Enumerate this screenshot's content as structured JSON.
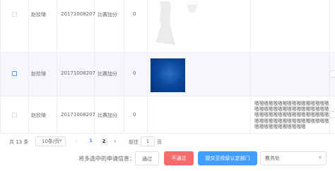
{
  "table": {
    "rows": [
      {
        "name": "赵欣琦",
        "id": "20171008207",
        "type": "比赛加分",
        "score": "0",
        "selected": false
      },
      {
        "name": "赵欣琦",
        "id": "20171008207",
        "type": "比赛加分",
        "score": "0",
        "selected": false
      },
      {
        "name": "赵欣琦",
        "id": "20171008207",
        "type": "比赛加分",
        "score": "0",
        "selected": false
      }
    ],
    "garbled_text": "嗷嗷嗷嗷嗷嗷嗷嗷嗷嗷嗷嗷嗷嗷嗷嗷嗷嗷嗷嗷嗷嗷嗷嗷嗷嗷嗷嗷嗷嗷嗷嗷嗷嗷嗷嗷嗷嗷嗷嗷嗷嗷嗷嗷嗷嗷嗷嗷嗷嗷嗷嗷嗷嗷嗷嗷嗷嗷嗷嗷嗷嗷嗷嗷嗷嗷嗷嗷嗷嗷嗷嗷嗷嗷嗷"
  },
  "pagination": {
    "total": "共 13 条",
    "page_size": "10条/页",
    "prev": "‹",
    "pages": [
      "1",
      "2"
    ],
    "current_page": "1",
    "next": "›",
    "goto_label": "前往",
    "goto_value": "1",
    "page_suffix": "页"
  },
  "actions": {
    "prompt": "将多选中的申请信息：",
    "pass_label": "通过",
    "reject_label": "不通过",
    "submit_label": "提交至校级认定部门",
    "department": "教务处",
    "colors": {
      "primary": "#409eff",
      "danger": "#f56c6c"
    }
  },
  "icons": {
    "prev": "chevron-left-icon",
    "next": "chevron-right-icon",
    "dropdown": "chevron-down-icon"
  }
}
